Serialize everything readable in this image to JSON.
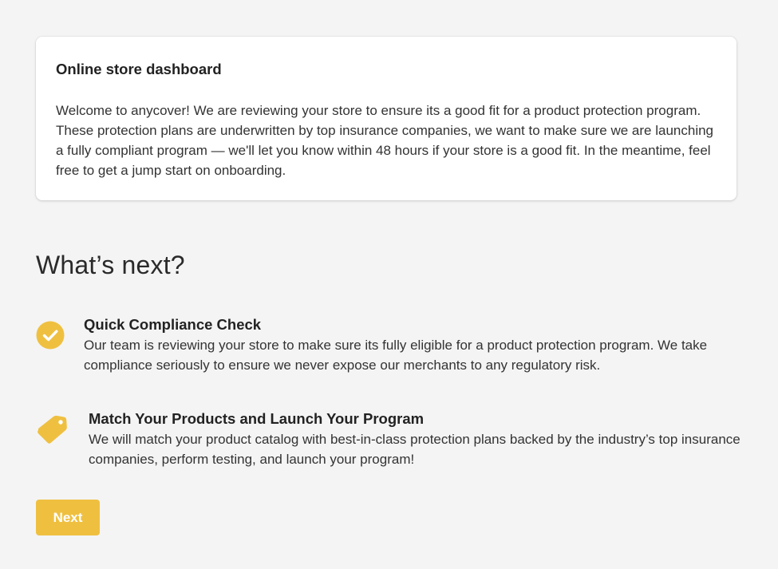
{
  "card": {
    "title": "Online store dashboard",
    "body": "Welcome to anycover! We are reviewing your store to ensure its a good fit for a product protection program. These protection plans are underwritten by top insurance companies, we want to make sure we are launching a fully compliant program — we'll let you know within 48 hours if your store is a good fit. In the meantime, feel free to get a jump start on onboarding."
  },
  "whats_next": {
    "title": "What’s next?",
    "steps": [
      {
        "icon": "check-circle-icon",
        "title": "Quick Compliance Check",
        "description": "Our team is reviewing your store to make sure its fully eligible for a product protection program. We take compliance seriously to ensure we never expose our merchants to any regulatory risk."
      },
      {
        "icon": "price-tag-icon",
        "title": "Match Your Products and Launch Your Program",
        "description": "We will match your product catalog with best-in-class protection plans backed by the industry’s top insurance companies, perform testing, and launch your program!"
      }
    ]
  },
  "next_button": {
    "label": "Next"
  },
  "colors": {
    "accent": "#efc040",
    "background": "#f4f4f4",
    "card": "#ffffff"
  }
}
